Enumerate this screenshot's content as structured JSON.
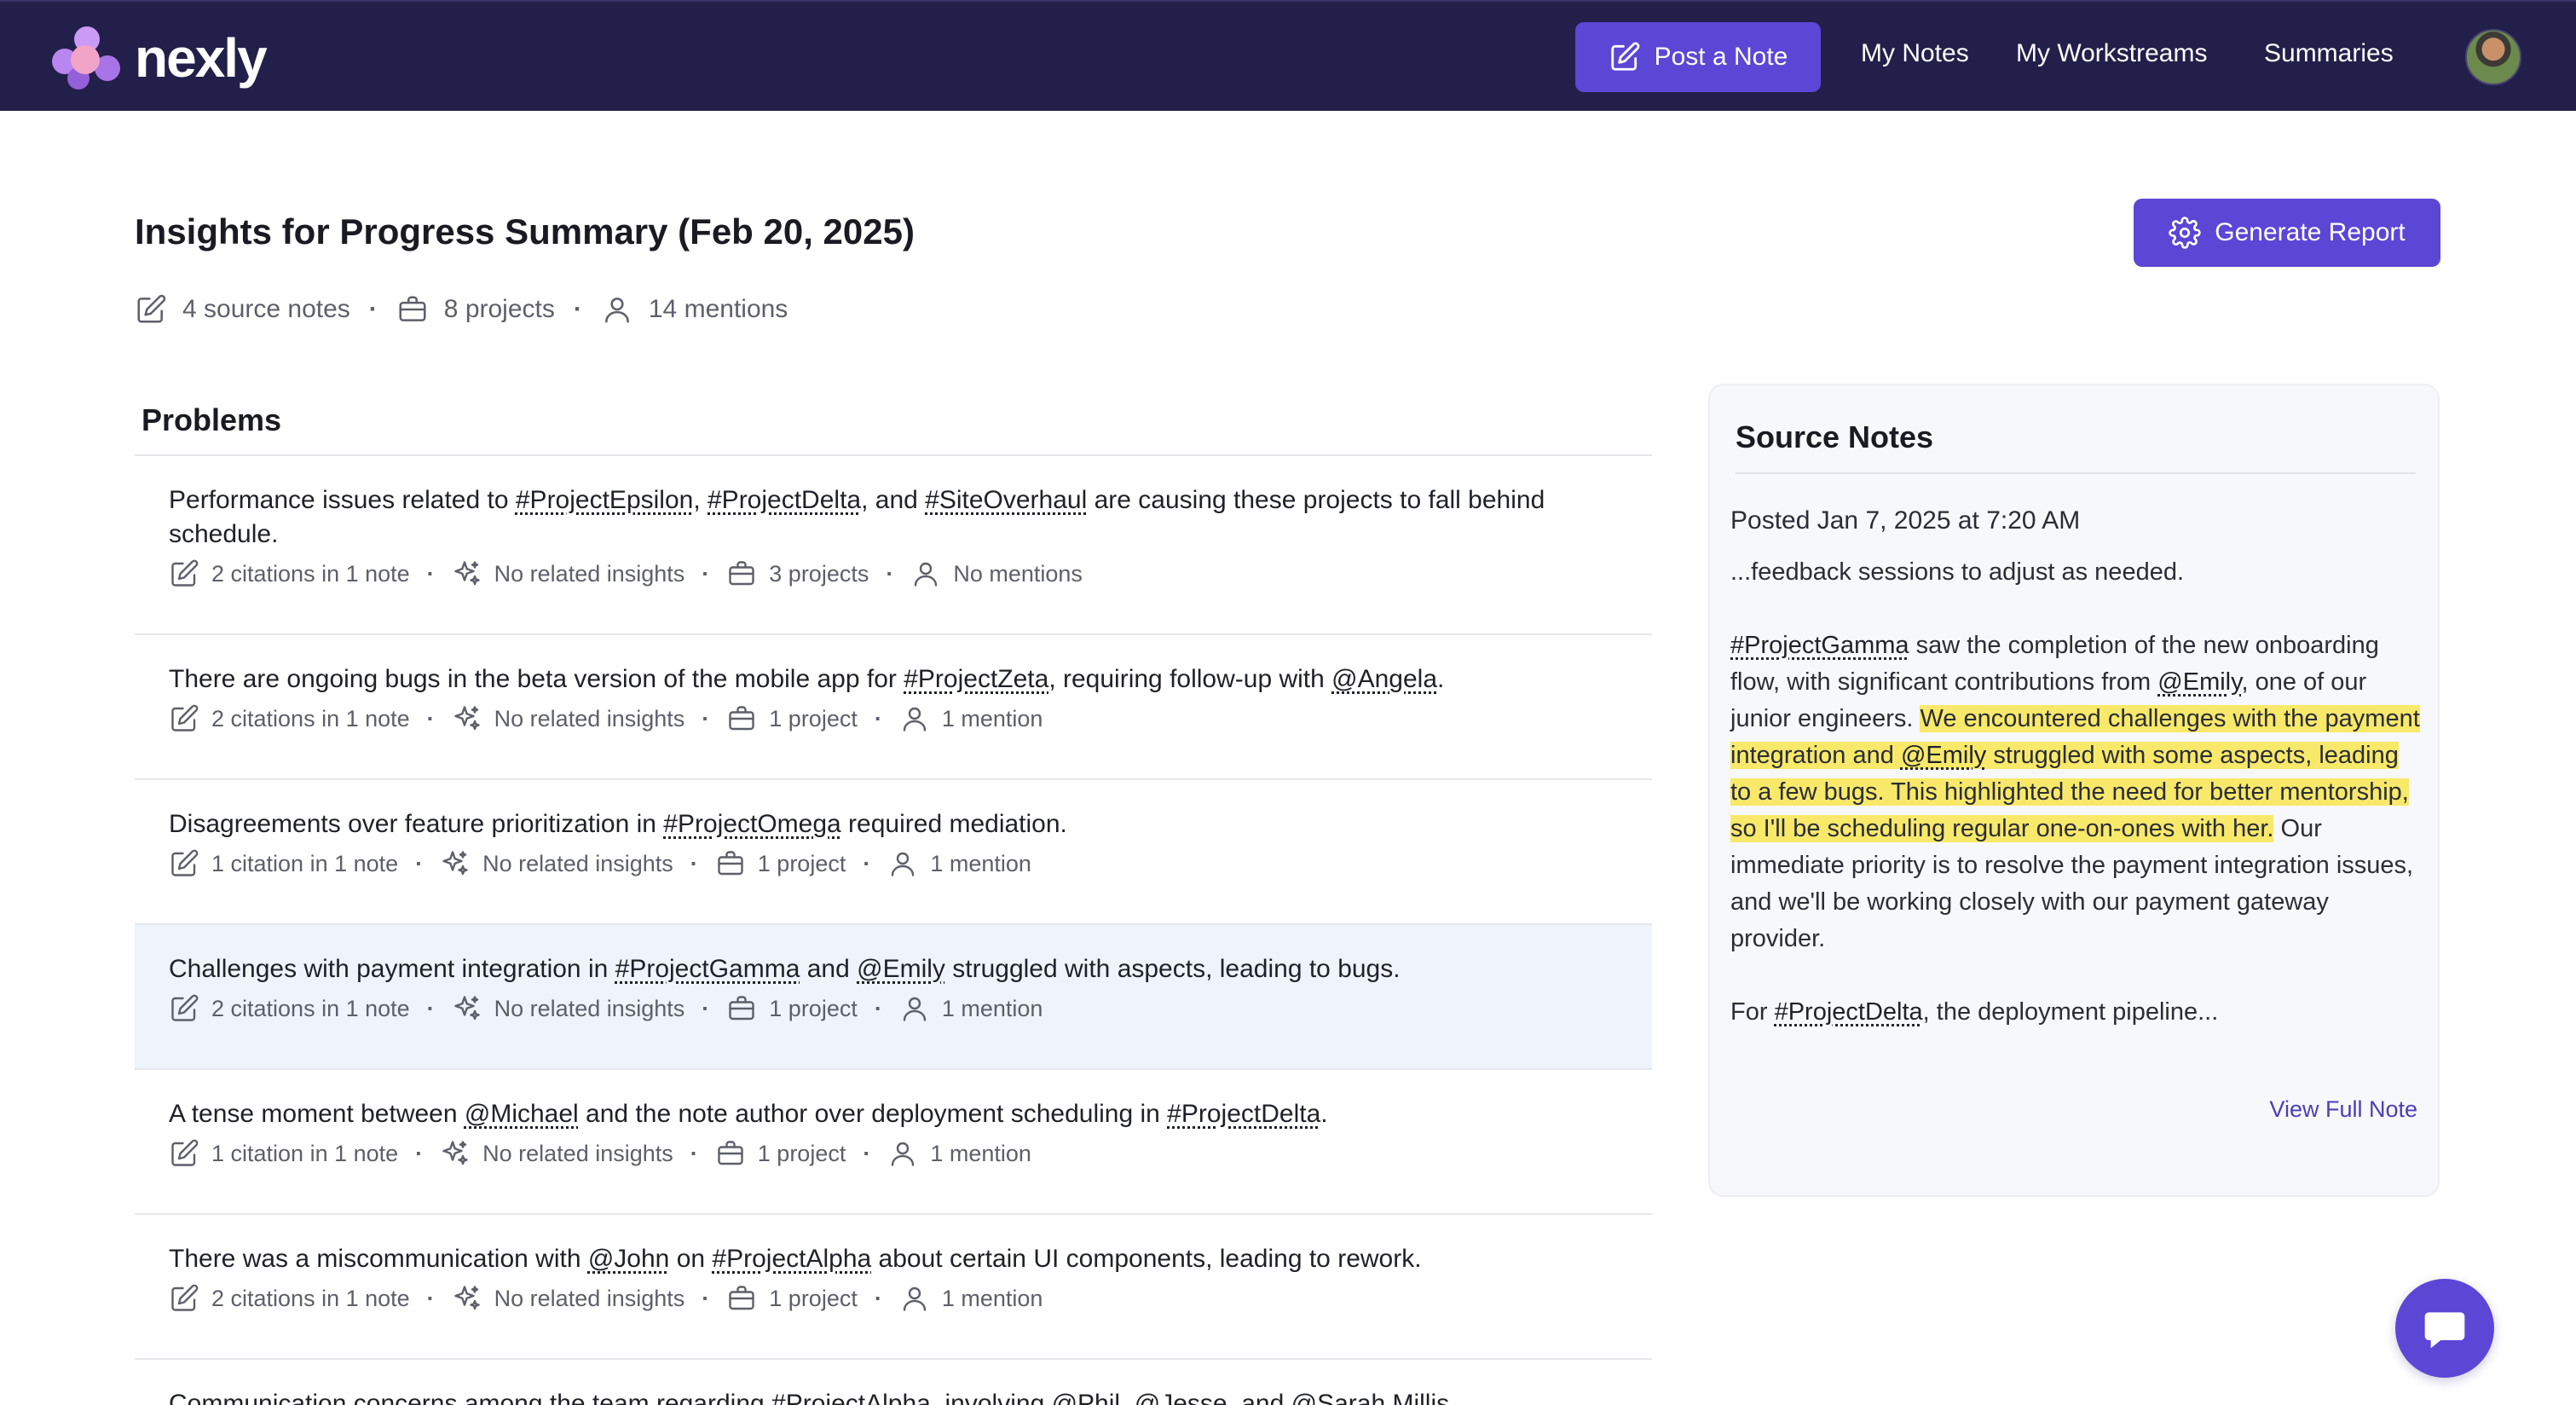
{
  "nav": {
    "brand": "nexly",
    "post_note": "Post a Note",
    "links": [
      "My Notes",
      "My Workstreams",
      "Summaries"
    ]
  },
  "page": {
    "title": "Insights for Progress Summary (Feb 20, 2025)",
    "meta": {
      "source_notes": "4 source notes",
      "projects": "8 projects",
      "mentions": "14 mentions"
    },
    "generate_report": "Generate Report"
  },
  "problems": {
    "title": "Problems",
    "items": [
      {
        "segments": [
          {
            "t": "Performance issues related to "
          },
          {
            "t": "#ProjectEpsilon",
            "tag": true
          },
          {
            "t": ", "
          },
          {
            "t": "#ProjectDelta",
            "tag": true
          },
          {
            "t": ", and "
          },
          {
            "t": "#SiteOverhaul",
            "tag": true
          },
          {
            "t": " are causing these projects to fall behind schedule."
          }
        ],
        "citations": "2 citations in 1 note",
        "insights": "No related insights",
        "projects": "3 projects",
        "mentions": "No mentions",
        "highlighted": false
      },
      {
        "segments": [
          {
            "t": "There are ongoing bugs in the beta version of the mobile app for "
          },
          {
            "t": "#ProjectZeta",
            "tag": true
          },
          {
            "t": ", requiring follow-up with "
          },
          {
            "t": "@Angela",
            "tag": true
          },
          {
            "t": "."
          }
        ],
        "citations": "2 citations in 1 note",
        "insights": "No related insights",
        "projects": "1 project",
        "mentions": "1 mention",
        "highlighted": false
      },
      {
        "segments": [
          {
            "t": "Disagreements over feature prioritization in "
          },
          {
            "t": "#ProjectOmega",
            "tag": true
          },
          {
            "t": " required mediation."
          }
        ],
        "citations": "1 citation in 1 note",
        "insights": "No related insights",
        "projects": "1 project",
        "mentions": "1 mention",
        "highlighted": false
      },
      {
        "segments": [
          {
            "t": "Challenges with payment integration in "
          },
          {
            "t": "#ProjectGamma",
            "tag": true
          },
          {
            "t": " and "
          },
          {
            "t": "@Emily",
            "tag": true
          },
          {
            "t": " struggled with aspects, leading to bugs."
          }
        ],
        "citations": "2 citations in 1 note",
        "insights": "No related insights",
        "projects": "1 project",
        "mentions": "1 mention",
        "highlighted": true
      },
      {
        "segments": [
          {
            "t": "A tense moment between "
          },
          {
            "t": "@Michael",
            "tag": true
          },
          {
            "t": " and the note author over deployment scheduling in "
          },
          {
            "t": "#ProjectDelta",
            "tag": true
          },
          {
            "t": "."
          }
        ],
        "citations": "1 citation in 1 note",
        "insights": "No related insights",
        "projects": "1 project",
        "mentions": "1 mention",
        "highlighted": false
      },
      {
        "segments": [
          {
            "t": "There was a miscommunication with "
          },
          {
            "t": "@John",
            "tag": true
          },
          {
            "t": " on "
          },
          {
            "t": "#ProjectAlpha",
            "tag": true
          },
          {
            "t": " about certain UI components, leading to rework."
          }
        ],
        "citations": "2 citations in 1 note",
        "insights": "No related insights",
        "projects": "1 project",
        "mentions": "1 mention",
        "highlighted": false
      },
      {
        "segments": [
          {
            "t": "Communication concerns among the team regarding "
          },
          {
            "t": "#ProjectAlpha",
            "tag": true
          },
          {
            "t": ", involving "
          },
          {
            "t": "@Phil",
            "tag": true
          },
          {
            "t": ", "
          },
          {
            "t": "@Jesse",
            "tag": true
          },
          {
            "t": ", and "
          },
          {
            "t": "@Sarah Millis",
            "tag": true
          }
        ],
        "citations": "",
        "insights": "",
        "projects": "",
        "mentions": "",
        "highlighted": false
      }
    ]
  },
  "source_notes": {
    "title": "Source Notes",
    "posted": "Posted Jan 7, 2025 at 7:20 AM",
    "paragraphs": [
      [
        {
          "t": "...feedback sessions to adjust as needed."
        }
      ],
      [
        {
          "t": "#ProjectGamma",
          "tag": true
        },
        {
          "t": " saw the completion of the new onboarding flow, with significant contributions from "
        },
        {
          "t": "@Emily",
          "tag": true
        },
        {
          "t": ", one of our junior engineers. "
        },
        {
          "t": "We encountered challenges with the payment integration and ",
          "mark": true
        },
        {
          "t": "@Emily",
          "tag": true,
          "mark": true
        },
        {
          "t": " struggled with some aspects, leading to a few bugs. This highlighted the need for better mentorship, so I'll be scheduling regular one-on-ones with her.",
          "mark": true
        },
        {
          "t": " Our immediate priority is to resolve the payment integration issues, and we'll be working closely with our payment gateway provider."
        }
      ],
      [
        {
          "t": "For "
        },
        {
          "t": "#ProjectDelta",
          "tag": true
        },
        {
          "t": ", the deployment pipeline..."
        }
      ]
    ],
    "view_full": "View Full Note"
  }
}
